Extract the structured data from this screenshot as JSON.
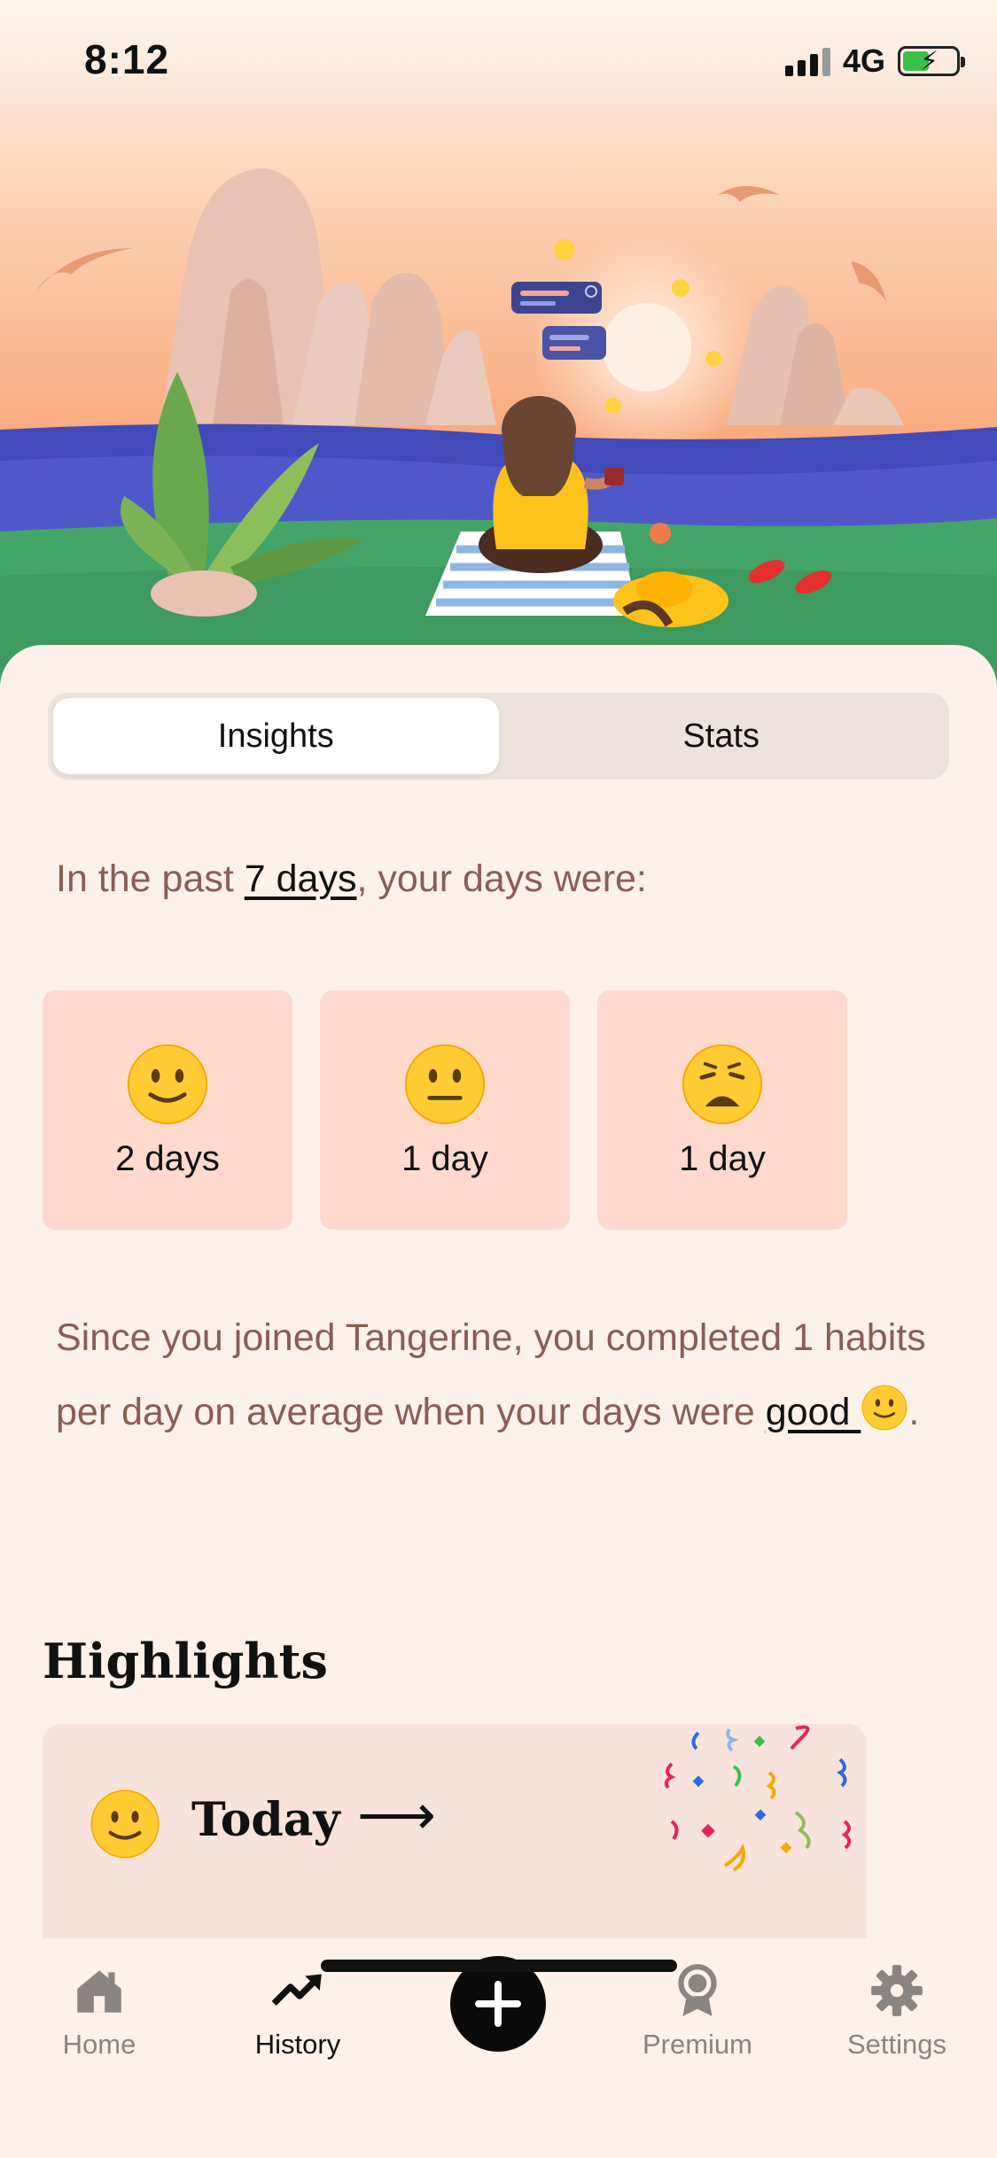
{
  "status_bar": {
    "time": "8:12",
    "network": "4G"
  },
  "tabs_segment": {
    "insights": "Insights",
    "stats": "Stats",
    "active": "Insights"
  },
  "insights": {
    "intro_prefix": "In the past ",
    "intro_period": "7 days",
    "intro_suffix": ", your days were:",
    "moods": [
      {
        "icon": "slightly-smiling-face-icon",
        "count": "2 days"
      },
      {
        "icon": "neutral-face-icon",
        "count": "1 day"
      },
      {
        "icon": "weary-face-icon",
        "count": "1 day"
      }
    ],
    "summary_text": "Since you joined Tangerine, you completed 1 habits per day on average when your days were ",
    "summary_link": "good ",
    "summary_end": "."
  },
  "highlights": {
    "title": "Highlights",
    "today_label": "Today",
    "arrow": "⟶"
  },
  "tab_bar": {
    "items": [
      {
        "label": "Home",
        "icon": "house-icon"
      },
      {
        "label": "History",
        "icon": "trending-up-icon"
      },
      {
        "label": "",
        "icon": "plus-icon"
      },
      {
        "label": "Premium",
        "icon": "award-ribbon-icon"
      },
      {
        "label": "Settings",
        "icon": "gear-icon"
      }
    ],
    "active": "History"
  },
  "colors": {
    "background": "#FDF1EA",
    "mood_card": "#FDDACB",
    "body_text": "#8B5E53",
    "tab_inactive": "#8A8483"
  }
}
